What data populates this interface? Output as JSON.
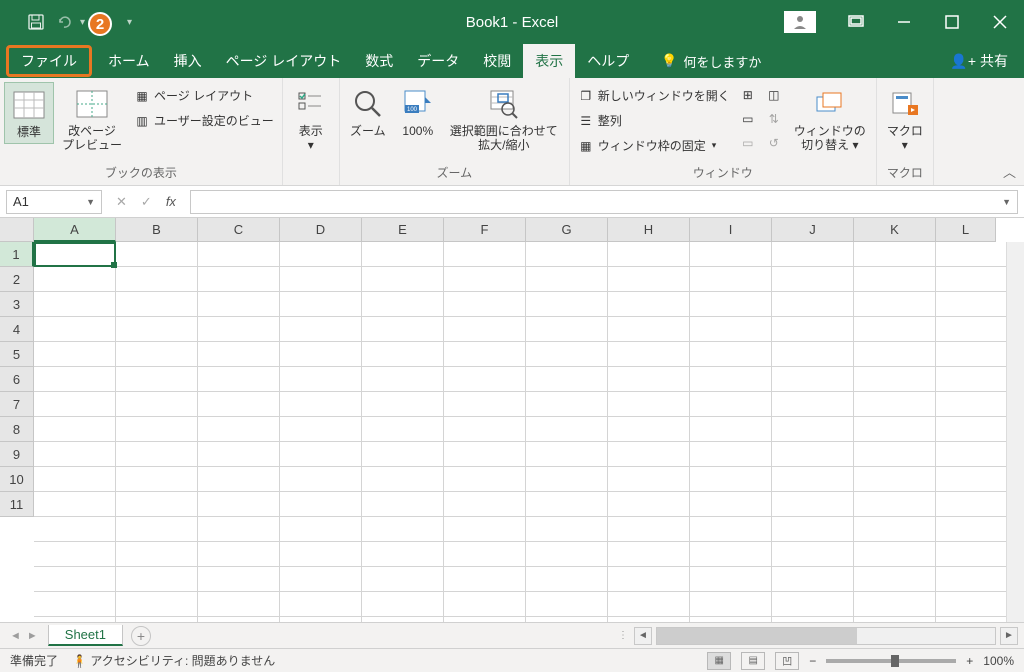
{
  "title": "Book1  -  Excel",
  "callout_number": "2",
  "tabs": {
    "file": "ファイル",
    "home": "ホーム",
    "insert": "挿入",
    "page_layout": "ページ レイアウト",
    "formulas": "数式",
    "data": "データ",
    "review": "校閲",
    "view": "表示",
    "help": "ヘルプ"
  },
  "tellme": "何をしますか",
  "share": "共有",
  "ribbon": {
    "views_group": "ブックの表示",
    "zoom_group": "ズーム",
    "window_group": "ウィンドウ",
    "macro_group": "マクロ",
    "normal": "標準",
    "page_break": "改ページ\nプレビュー",
    "page_layout_btn": "ページ レイアウト",
    "custom_views": "ユーザー設定のビュー",
    "show": "表示",
    "zoom": "ズーム",
    "zoom100": "100%",
    "zoom_selection": "選択範囲に合わせて\n拡大/縮小",
    "new_window": "新しいウィンドウを開く",
    "arrange": "整列",
    "freeze": "ウィンドウ枠の固定",
    "switch_windows": "ウィンドウの\n切り替え",
    "macros": "マクロ"
  },
  "namebox": "A1",
  "columns": [
    "A",
    "B",
    "C",
    "D",
    "E",
    "F",
    "G",
    "H",
    "I",
    "J",
    "K",
    "L"
  ],
  "rows": [
    "1",
    "2",
    "3",
    "4",
    "5",
    "6",
    "7",
    "8",
    "9",
    "10",
    "11"
  ],
  "sheet_tab": "Sheet1",
  "status": {
    "ready": "準備完了",
    "access": "アクセシビリティ: 問題ありません",
    "zoom": "100%"
  }
}
